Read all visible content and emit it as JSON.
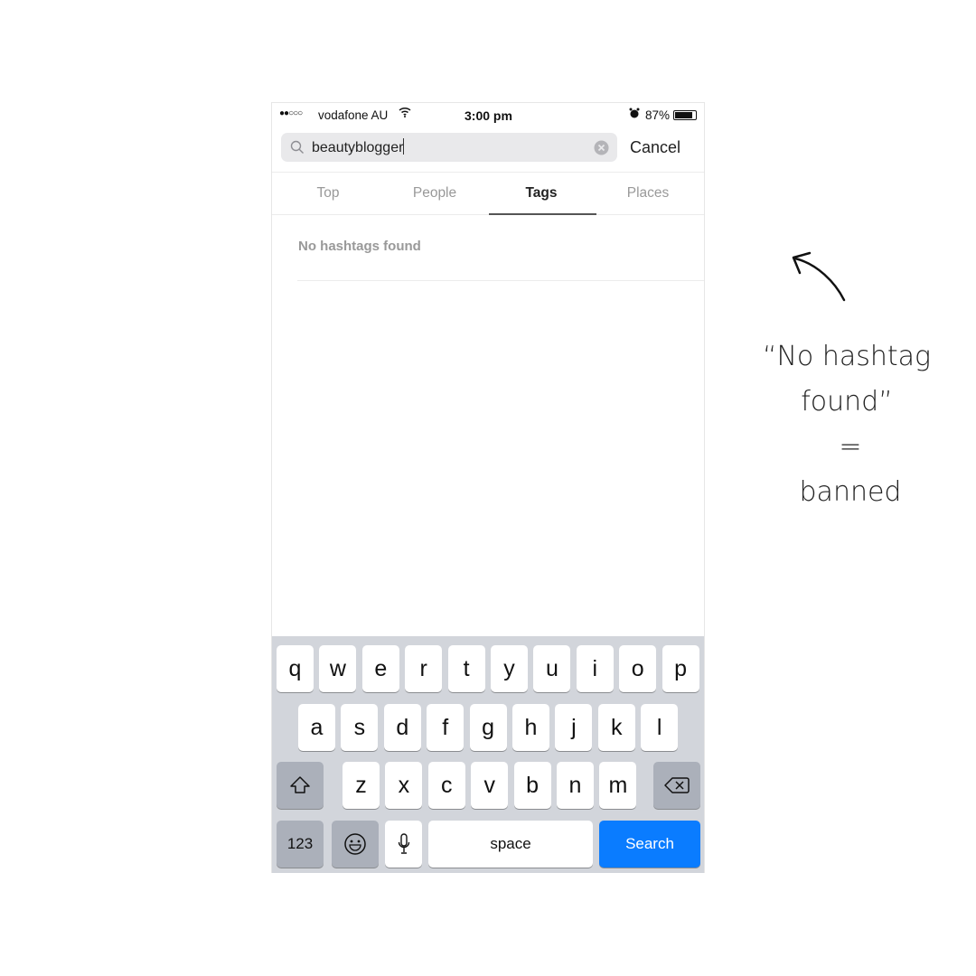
{
  "status_bar": {
    "carrier": "vodafone AU",
    "signal_dots": "●●○○○",
    "time": "3:00 pm",
    "battery": "87%",
    "battery_level": 0.87
  },
  "search": {
    "value": "beautyblogger",
    "cancel_label": "Cancel"
  },
  "tabs": [
    {
      "label": "Top"
    },
    {
      "label": "People"
    },
    {
      "label": "Tags",
      "active": true
    },
    {
      "label": "Places"
    }
  ],
  "results": {
    "empty_message": "No hashtags found"
  },
  "keyboard": {
    "row1": [
      "q",
      "w",
      "e",
      "r",
      "t",
      "y",
      "u",
      "i",
      "o",
      "p"
    ],
    "row2": [
      "a",
      "s",
      "d",
      "f",
      "g",
      "h",
      "j",
      "k",
      "l"
    ],
    "row3": [
      "z",
      "x",
      "c",
      "v",
      "b",
      "n",
      "m"
    ],
    "numbers_label": "123",
    "space_label": "space",
    "search_label": "Search"
  },
  "annotation": {
    "lines": [
      "“No hashtag",
      "found”",
      "=",
      "banned"
    ]
  },
  "colors": {
    "accent": "#0a7cff",
    "keyboard_bg": "#d2d5db"
  }
}
